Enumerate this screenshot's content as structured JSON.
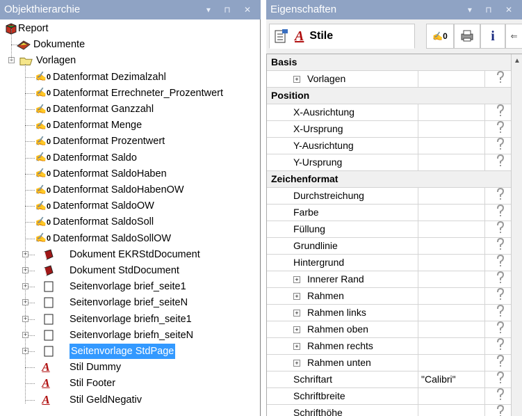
{
  "left_panel": {
    "title": "Objekthierarchie",
    "controls": "▾ ⊓ ✕"
  },
  "tree": {
    "root": "Report",
    "dokumente": "Dokumente",
    "vorlagen": "Vorlagen",
    "items": [
      {
        "label": "Datenformat Dezimalzahl",
        "icon": "number-format-icon"
      },
      {
        "label": "Datenformat Errechneter_Prozentwert",
        "icon": "number-format-icon"
      },
      {
        "label": "Datenformat Ganzzahl",
        "icon": "number-format-icon"
      },
      {
        "label": "Datenformat Menge",
        "icon": "number-format-icon"
      },
      {
        "label": "Datenformat Prozentwert",
        "icon": "number-format-icon"
      },
      {
        "label": "Datenformat Saldo",
        "icon": "number-format-icon"
      },
      {
        "label": "Datenformat SaldoHaben",
        "icon": "number-format-icon"
      },
      {
        "label": "Datenformat SaldoHabenOW",
        "icon": "number-format-icon"
      },
      {
        "label": "Datenformat SaldoOW",
        "icon": "number-format-icon"
      },
      {
        "label": "Datenformat SaldoSoll",
        "icon": "number-format-icon"
      },
      {
        "label": "Datenformat SaldoSollOW",
        "icon": "number-format-icon"
      },
      {
        "label": "Dokument EKRStdDocument",
        "icon": "document-book-icon"
      },
      {
        "label": "Dokument StdDocument",
        "icon": "document-book-icon"
      },
      {
        "label": "Seitenvorlage brief_seite1",
        "icon": "page-icon"
      },
      {
        "label": "Seitenvorlage brief_seiteN",
        "icon": "page-icon"
      },
      {
        "label": "Seitenvorlage briefn_seite1",
        "icon": "page-icon"
      },
      {
        "label": "Seitenvorlage briefn_seiteN",
        "icon": "page-icon"
      },
      {
        "label": "Seitenvorlage StdPage",
        "icon": "page-icon",
        "selected": true
      },
      {
        "label": "Stil Dummy",
        "icon": "style-icon"
      },
      {
        "label": "Stil Footer",
        "icon": "style-icon"
      },
      {
        "label": "Stil GeldNegativ",
        "icon": "style-icon"
      }
    ]
  },
  "right_panel": {
    "title": "Eigenschaften",
    "controls": "▾ ⊓ ✕",
    "tab_stile": "Stile",
    "format_icon_text": "0"
  },
  "properties": {
    "basis": "Basis",
    "basis_items": [
      {
        "name": "Vorlagen",
        "expandable": true,
        "value": ""
      }
    ],
    "position": "Position",
    "position_items": [
      {
        "name": "X-Ausrichtung",
        "value": ""
      },
      {
        "name": "X-Ursprung",
        "value": ""
      },
      {
        "name": "Y-Ausrichtung",
        "value": ""
      },
      {
        "name": "Y-Ursprung",
        "value": ""
      }
    ],
    "zeichenformat": "Zeichenformat",
    "zeichen_items": [
      {
        "name": "Durchstreichung",
        "value": ""
      },
      {
        "name": "Farbe",
        "value": ""
      },
      {
        "name": "Füllung",
        "value": ""
      },
      {
        "name": "Grundlinie",
        "value": ""
      },
      {
        "name": "Hintergrund",
        "value": ""
      },
      {
        "name": "Innerer Rand",
        "expandable": true,
        "value": ""
      },
      {
        "name": "Rahmen",
        "expandable": true,
        "value": ""
      },
      {
        "name": "Rahmen links",
        "expandable": true,
        "value": ""
      },
      {
        "name": "Rahmen oben",
        "expandable": true,
        "value": ""
      },
      {
        "name": "Rahmen rechts",
        "expandable": true,
        "value": ""
      },
      {
        "name": "Rahmen unten",
        "expandable": true,
        "value": ""
      },
      {
        "name": "Schriftart",
        "value": "\"Calibri\""
      },
      {
        "name": "Schriftbreite",
        "value": ""
      },
      {
        "name": "Schrifthöhe",
        "value": ""
      }
    ]
  },
  "colors": {
    "title_bar": "#8fa3c4",
    "selection": "#3399ff",
    "style_icon": "#b01010"
  }
}
